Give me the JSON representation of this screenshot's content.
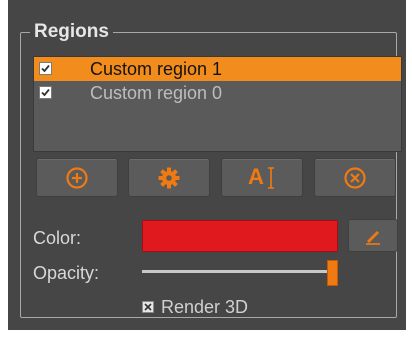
{
  "group": {
    "title": "Regions"
  },
  "regions": [
    {
      "label": "Custom region 1",
      "checked": true,
      "selected": true
    },
    {
      "label": "Custom region 0",
      "checked": true,
      "selected": false
    }
  ],
  "toolbar": {
    "buttons": [
      {
        "icon": "plus-circle-icon"
      },
      {
        "icon": "gear-icon"
      },
      {
        "icon": "text-cursor-icon",
        "glyph": "A"
      },
      {
        "icon": "close-circle-icon"
      }
    ]
  },
  "color": {
    "label": "Color:",
    "value": "#e0191f"
  },
  "opacity": {
    "label": "Opacity:",
    "value": 1.0
  },
  "render3d": {
    "label": "Render 3D",
    "checked": true
  },
  "accent": "#f28c1c"
}
